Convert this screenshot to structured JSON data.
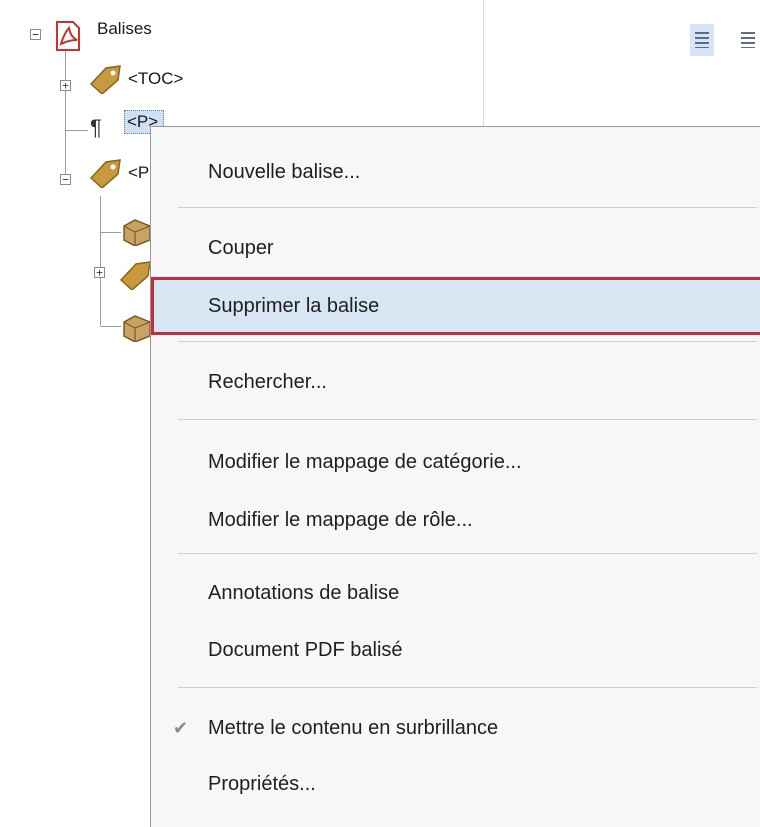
{
  "tree": {
    "root_label": "Balises",
    "nodes": [
      {
        "label": "<TOC>"
      },
      {
        "label": "<P>"
      },
      {
        "label": "<P"
      }
    ]
  },
  "context_menu": {
    "items": {
      "new_tag": "Nouvelle balise...",
      "cut": "Couper",
      "delete_tag": "Supprimer la balise",
      "search": "Rechercher...",
      "edit_category": "Modifier le mappage de catégorie...",
      "edit_role": "Modifier le mappage de rôle...",
      "tag_annotations": "Annotations de balise",
      "tagged_pdf": "Document PDF balisé",
      "highlight": "Mettre le contenu en surbrillance",
      "properties": "Propriétés..."
    },
    "highlighted_item": "Supprimer la balise",
    "highlight_outline_color": "#c0303a",
    "checked_item": "Mettre le contenu en surbrillance"
  }
}
